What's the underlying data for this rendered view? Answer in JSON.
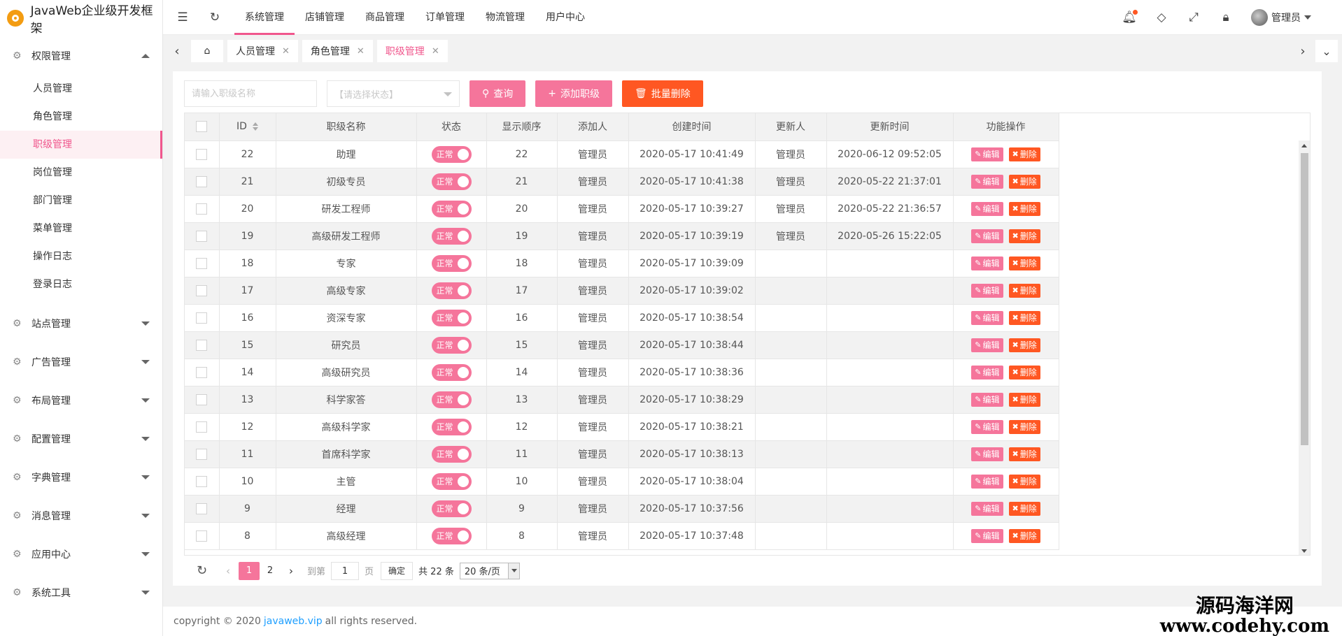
{
  "app": {
    "title": "JavaWeb企业级开发框架"
  },
  "sidebar": {
    "groups": [
      {
        "label": "权限管理",
        "expanded": true
      },
      {
        "label": "站点管理"
      },
      {
        "label": "广告管理"
      },
      {
        "label": "布局管理"
      },
      {
        "label": "配置管理"
      },
      {
        "label": "字典管理"
      },
      {
        "label": "消息管理"
      },
      {
        "label": "应用中心"
      },
      {
        "label": "系统工具"
      }
    ],
    "sub_items": [
      {
        "label": "人员管理"
      },
      {
        "label": "角色管理"
      },
      {
        "label": "职级管理",
        "active": true
      },
      {
        "label": "岗位管理"
      },
      {
        "label": "部门管理"
      },
      {
        "label": "菜单管理"
      },
      {
        "label": "操作日志"
      },
      {
        "label": "登录日志"
      }
    ]
  },
  "topnav": {
    "items": [
      "系统管理",
      "店铺管理",
      "商品管理",
      "订单管理",
      "物流管理",
      "用户中心"
    ],
    "user": "管理员"
  },
  "tabs": [
    {
      "label": "人员管理"
    },
    {
      "label": "角色管理"
    },
    {
      "label": "职级管理",
      "active": true
    }
  ],
  "toolbar": {
    "search_placeholder": "请输入职级名称",
    "status_placeholder": "【请选择状态】",
    "query_label": "查询",
    "add_label": "添加职级",
    "batch_delete_label": "批量删除"
  },
  "table": {
    "columns": [
      "ID",
      "职级名称",
      "状态",
      "显示顺序",
      "添加人",
      "创建时间",
      "更新人",
      "更新时间",
      "功能操作"
    ],
    "status_label": "正常",
    "edit_label": "编辑",
    "delete_label": "删除",
    "rows": [
      {
        "id": "22",
        "name": "助理",
        "order": "22",
        "creator": "管理员",
        "created": "2020-05-17 10:41:49",
        "updater": "管理员",
        "updated": "2020-06-12 09:52:05"
      },
      {
        "id": "21",
        "name": "初级专员",
        "order": "21",
        "creator": "管理员",
        "created": "2020-05-17 10:41:38",
        "updater": "管理员",
        "updated": "2020-05-22 21:37:01"
      },
      {
        "id": "20",
        "name": "研发工程师",
        "order": "20",
        "creator": "管理员",
        "created": "2020-05-17 10:39:27",
        "updater": "管理员",
        "updated": "2020-05-22 21:36:57"
      },
      {
        "id": "19",
        "name": "高级研发工程师",
        "order": "19",
        "creator": "管理员",
        "created": "2020-05-17 10:39:19",
        "updater": "管理员",
        "updated": "2020-05-26 15:22:05"
      },
      {
        "id": "18",
        "name": "专家",
        "order": "18",
        "creator": "管理员",
        "created": "2020-05-17 10:39:09",
        "updater": "",
        "updated": ""
      },
      {
        "id": "17",
        "name": "高级专家",
        "order": "17",
        "creator": "管理员",
        "created": "2020-05-17 10:39:02",
        "updater": "",
        "updated": ""
      },
      {
        "id": "16",
        "name": "资深专家",
        "order": "16",
        "creator": "管理员",
        "created": "2020-05-17 10:38:54",
        "updater": "",
        "updated": ""
      },
      {
        "id": "15",
        "name": "研究员",
        "order": "15",
        "creator": "管理员",
        "created": "2020-05-17 10:38:44",
        "updater": "",
        "updated": ""
      },
      {
        "id": "14",
        "name": "高级研究员",
        "order": "14",
        "creator": "管理员",
        "created": "2020-05-17 10:38:36",
        "updater": "",
        "updated": ""
      },
      {
        "id": "13",
        "name": "科学家答",
        "order": "13",
        "creator": "管理员",
        "created": "2020-05-17 10:38:29",
        "updater": "",
        "updated": ""
      },
      {
        "id": "12",
        "name": "高级科学家",
        "order": "12",
        "creator": "管理员",
        "created": "2020-05-17 10:38:21",
        "updater": "",
        "updated": ""
      },
      {
        "id": "11",
        "name": "首席科学家",
        "order": "11",
        "creator": "管理员",
        "created": "2020-05-17 10:38:13",
        "updater": "",
        "updated": ""
      },
      {
        "id": "10",
        "name": "主管",
        "order": "10",
        "creator": "管理员",
        "created": "2020-05-17 10:38:04",
        "updater": "",
        "updated": ""
      },
      {
        "id": "9",
        "name": "经理",
        "order": "9",
        "creator": "管理员",
        "created": "2020-05-17 10:37:56",
        "updater": "",
        "updated": ""
      },
      {
        "id": "8",
        "name": "高级经理",
        "order": "8",
        "creator": "管理员",
        "created": "2020-05-17 10:37:48",
        "updater": "",
        "updated": ""
      }
    ]
  },
  "pagination": {
    "pages": [
      "1",
      "2"
    ],
    "current": "1",
    "goto_label": "到第",
    "page_input": "1",
    "page_unit": "页",
    "confirm_label": "确定",
    "total_label": "共 22 条",
    "page_size": "20 条/页"
  },
  "footer": {
    "prefix": "copyright © 2020",
    "link": "javaweb.vip",
    "suffix": "all rights reserved."
  },
  "watermark": {
    "line1": "源码海洋网",
    "line2": "www.codehy.com"
  },
  "colors": {
    "accent": "#f5759b",
    "danger": "#ff5722",
    "active_text": "#f0578d",
    "link": "#1e9fff"
  }
}
